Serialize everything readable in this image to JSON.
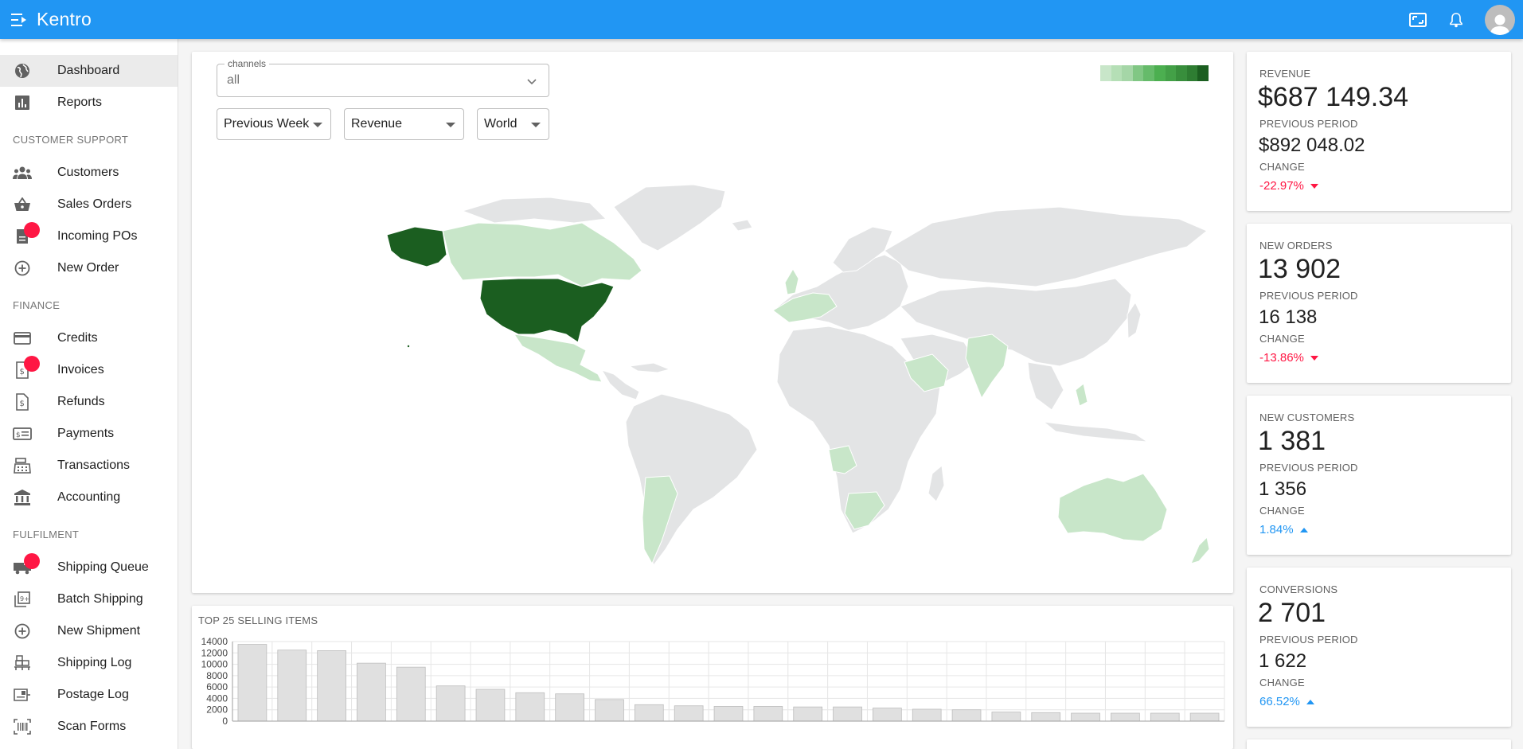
{
  "app": {
    "title": "Kentro"
  },
  "sidebar": {
    "items": [
      {
        "label": "Dashboard",
        "icon": "globe-icon",
        "active": true
      },
      {
        "label": "Reports",
        "icon": "bar-chart-icon"
      }
    ],
    "sections": [
      {
        "title": "CUSTOMER SUPPORT",
        "items": [
          {
            "label": "Customers",
            "icon": "people-icon"
          },
          {
            "label": "Sales Orders",
            "icon": "basket-icon"
          },
          {
            "label": "Incoming POs",
            "icon": "document-icon",
            "badge": true
          },
          {
            "label": "New Order",
            "icon": "add-circle-icon"
          }
        ]
      },
      {
        "title": "FINANCE",
        "items": [
          {
            "label": "Credits",
            "icon": "credit-card-icon"
          },
          {
            "label": "Invoices",
            "icon": "invoice-icon",
            "badge": true
          },
          {
            "label": "Refunds",
            "icon": "refund-icon"
          },
          {
            "label": "Payments",
            "icon": "payments-icon"
          },
          {
            "label": "Transactions",
            "icon": "register-icon"
          },
          {
            "label": "Accounting",
            "icon": "bank-icon"
          }
        ]
      },
      {
        "title": "FULFILMENT",
        "items": [
          {
            "label": "Shipping Queue",
            "icon": "truck-icon",
            "badge": true
          },
          {
            "label": "Batch Shipping",
            "icon": "batch-icon"
          },
          {
            "label": "New Shipment",
            "icon": "add-circle-icon"
          },
          {
            "label": "Shipping Log",
            "icon": "pallet-icon"
          },
          {
            "label": "Postage Log",
            "icon": "postage-icon"
          },
          {
            "label": "Scan Forms",
            "icon": "barcode-icon"
          }
        ]
      }
    ]
  },
  "filters": {
    "channels_label": "channels",
    "channels_value": "all",
    "period": "Previous Week",
    "metric": "Revenue",
    "region": "World"
  },
  "legend_colors": [
    "#c8e6c9",
    "#b5dfb6",
    "#a5d6a7",
    "#81c784",
    "#66bb6a",
    "#4caf50",
    "#43a047",
    "#388e3c",
    "#2e7d32",
    "#1b5e20"
  ],
  "stats": [
    {
      "title": "REVENUE",
      "value": "$687 149.34",
      "prev_label": "PREVIOUS PERIOD",
      "prev": "$892 048.02",
      "change_label": "CHANGE",
      "change": "-22.97%",
      "direction": "down"
    },
    {
      "title": "NEW ORDERS",
      "value": "13 902",
      "prev_label": "PREVIOUS PERIOD",
      "prev": "16 138",
      "change_label": "CHANGE",
      "change": "-13.86%",
      "direction": "down"
    },
    {
      "title": "NEW CUSTOMERS",
      "value": "1 381",
      "prev_label": "PREVIOUS PERIOD",
      "prev": "1 356",
      "change_label": "CHANGE",
      "change": "1.84%",
      "direction": "up"
    },
    {
      "title": "CONVERSIONS",
      "value": "2 701",
      "prev_label": "PREVIOUS PERIOD",
      "prev": "1 622",
      "change_label": "CHANGE",
      "change": "66.52%",
      "direction": "up"
    }
  ],
  "top_items": {
    "title": "TOP 25 SELLING ITEMS"
  },
  "chart_data": {
    "type": "bar",
    "title": "TOP 25 SELLING ITEMS",
    "ylim": [
      0,
      14000
    ],
    "yticks": [
      0,
      2000,
      4000,
      6000,
      8000,
      10000,
      12000,
      14000
    ],
    "grid": true,
    "values": [
      13500,
      12500,
      12400,
      10200,
      9500,
      6200,
      5600,
      5000,
      4800,
      3800,
      2900,
      2700,
      2600,
      2600,
      2500,
      2500,
      2300,
      2100,
      2000,
      1600,
      1500,
      1400,
      1400,
      1400,
      1400
    ]
  }
}
